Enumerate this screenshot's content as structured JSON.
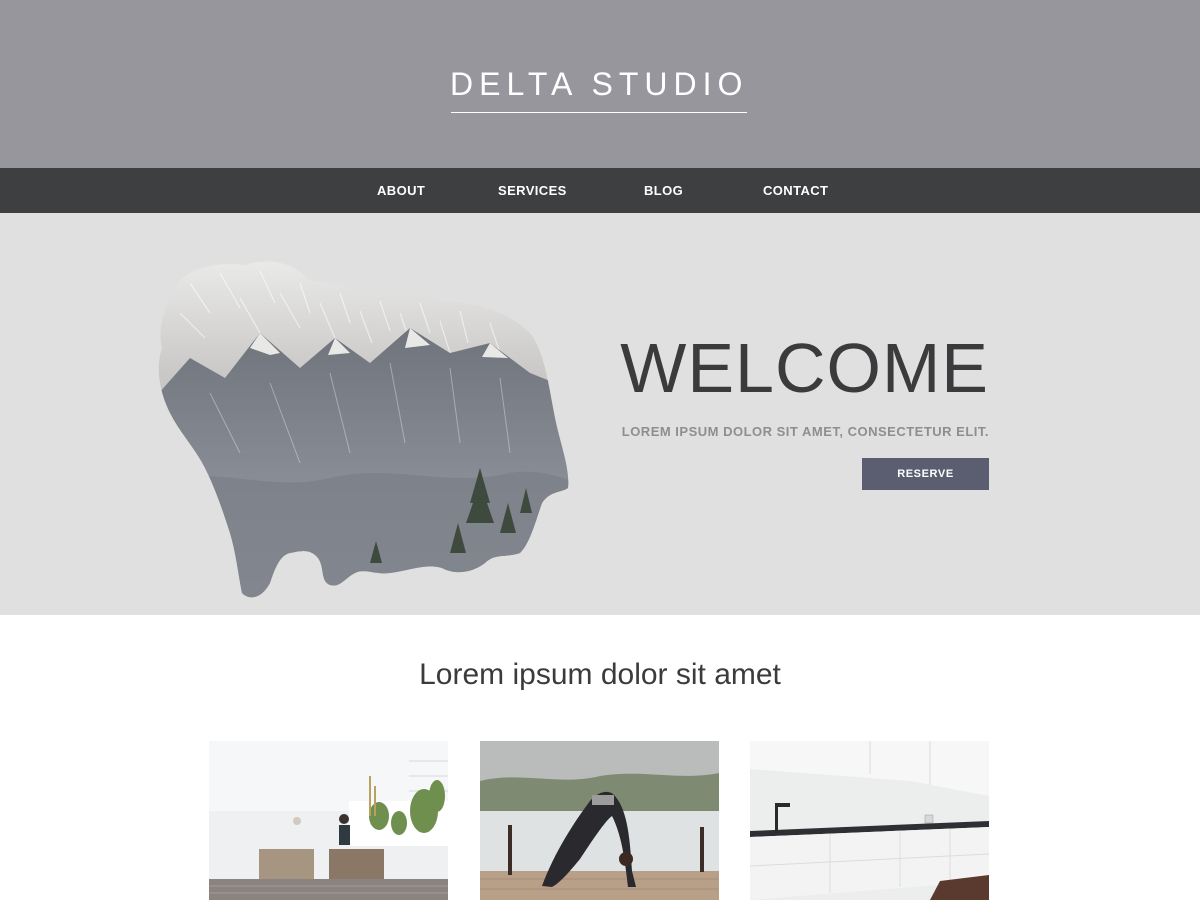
{
  "header": {
    "brand": "DELTA STUDIO"
  },
  "nav": {
    "items": [
      {
        "label": "ABOUT"
      },
      {
        "label": "SERVICES"
      },
      {
        "label": "BLOG"
      },
      {
        "label": "CONTACT"
      }
    ]
  },
  "hero": {
    "title": "WELCOME",
    "subtitle": "LOREM IPSUM DOLOR SIT AMET, CONSECTETUR ELIT.",
    "button_label": "RESERVE",
    "image": "bear-mountain-double-exposure"
  },
  "section": {
    "heading": "Lorem ipsum dolor sit amet"
  },
  "gallery": {
    "items": [
      {
        "image": "rooftop-terrace-photo"
      },
      {
        "image": "yoga-pose-lake-photo"
      },
      {
        "image": "white-kitchen-photo"
      }
    ]
  },
  "colors": {
    "header_bg": "#97969c",
    "nav_bg": "#3e3f40",
    "hero_bg": "#e0e0e0",
    "button_bg": "#5a5e70",
    "title_text": "#3b3b3d"
  }
}
